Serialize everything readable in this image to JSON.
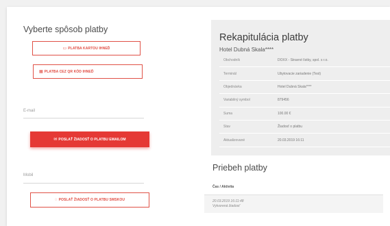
{
  "payment": {
    "title": "Vyberte spôsob platby",
    "card_button": "PLATBA KARTOU IHNEĎ",
    "qr_button": "PLATBA CEZ QR KÓD IHNEĎ",
    "email_label": "E-mail",
    "email_button": "POSLAŤ ŽIADOSŤ O PLATBU EMAILOM",
    "mobile_label": "Mobil",
    "sms_button": "POSLAŤ ŽIADOSŤ O PLATBU SMSKOU"
  },
  "icons": {
    "card": "credit-card-icon",
    "qr": "qr-code-icon",
    "email": "envelope-icon",
    "sms": "chat-bubble-icon"
  },
  "summary": {
    "title": "Rekapitulácia platby",
    "subtitle": "Hotel Dubná Skala****",
    "rows": [
      {
        "key": "Obchodník",
        "value": "DOXX - Stravné lístky, spol. s r.o."
      },
      {
        "key": "Terminál",
        "value": "Ubytovacie zariadenie (Test)"
      },
      {
        "key": "Objednávka",
        "value": "Hotel Dubná Skala****"
      },
      {
        "key": "Variabilný symbol",
        "value": "879456"
      },
      {
        "key": "Suma",
        "value": "100.00 €"
      },
      {
        "key": "Stav",
        "value": "Žiadosť o platbu"
      },
      {
        "key": "Aktualizované",
        "value": "20.03.2019 16:11"
      }
    ]
  },
  "history": {
    "title": "Priebeh platby",
    "column": "Čas / Aktivita",
    "entries": [
      {
        "time": "20.03.2019 16:11:48",
        "activity": "Vytvorená žiadosť"
      }
    ]
  },
  "colors": {
    "accent": "#e53935",
    "panel": "#eeeeee",
    "background": "#f1f1f1"
  }
}
